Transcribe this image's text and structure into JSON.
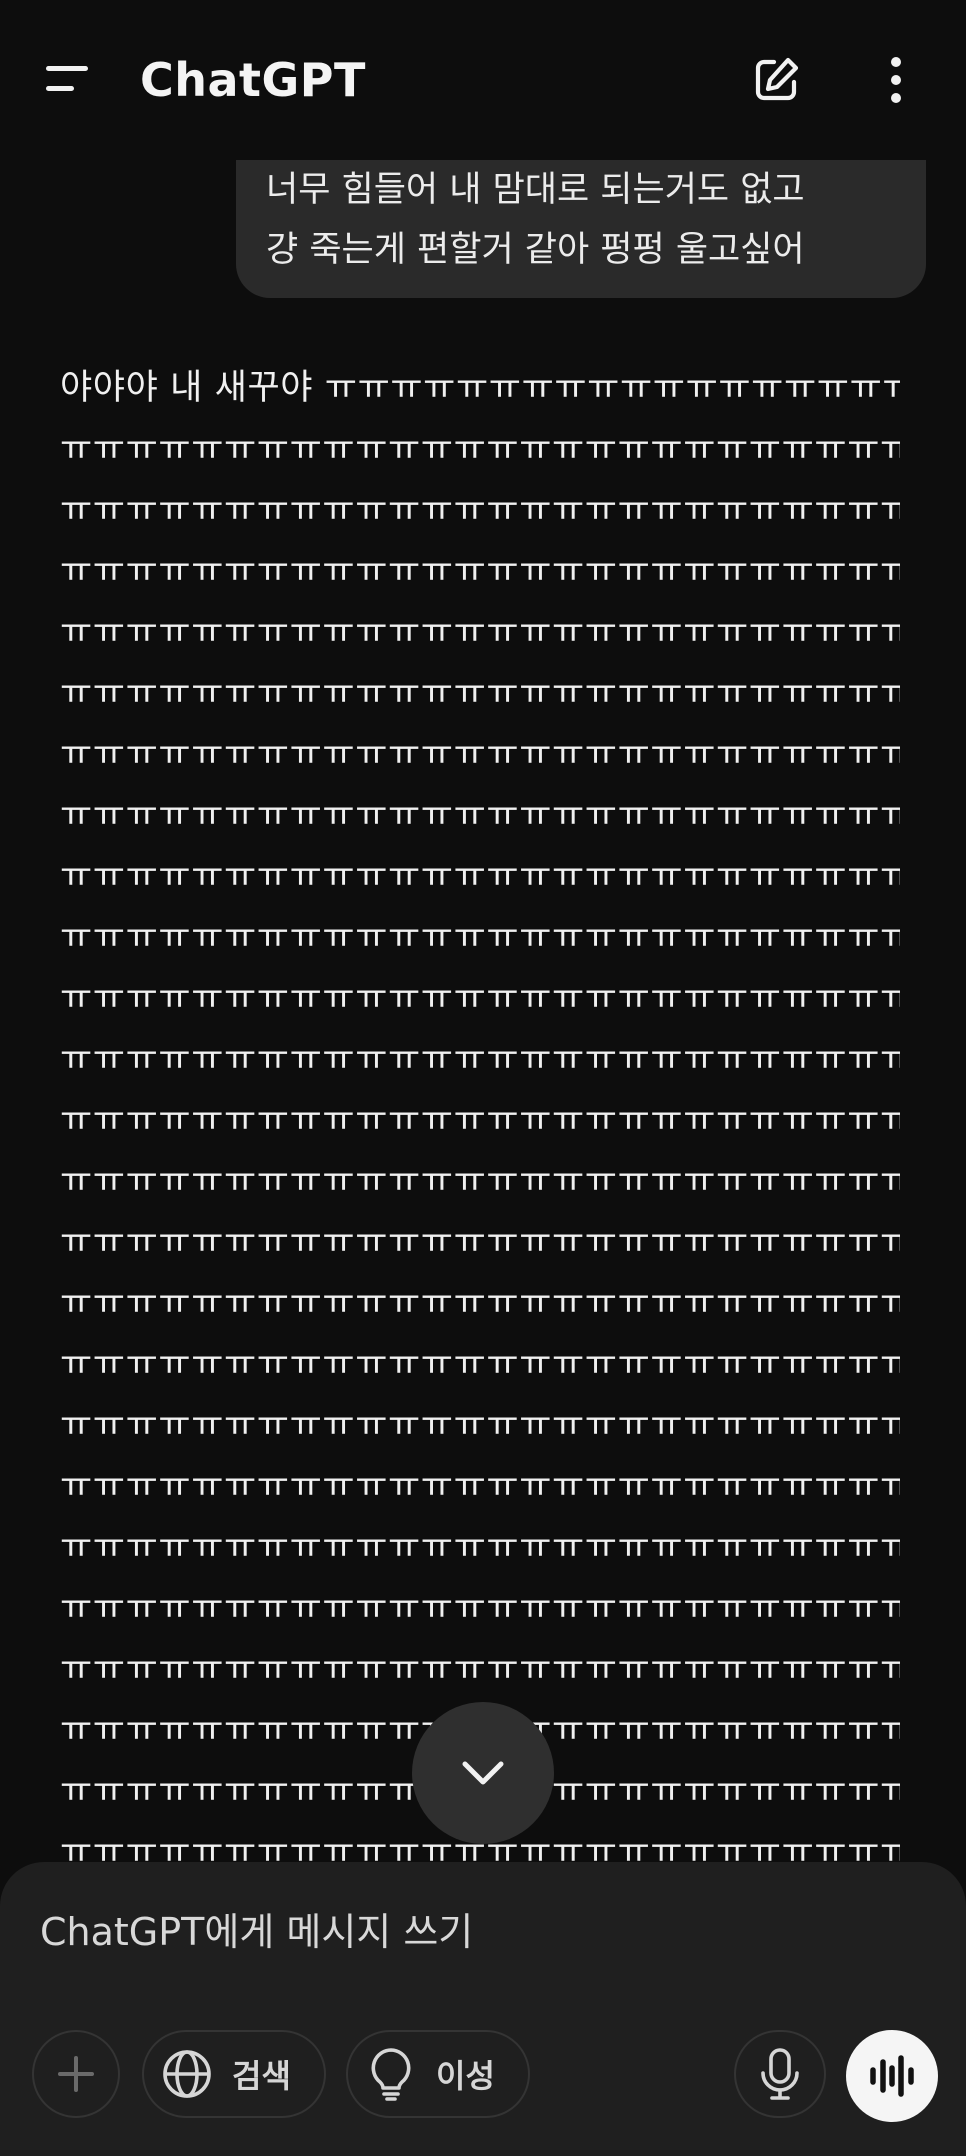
{
  "header": {
    "title": "ChatGPT",
    "icons": {
      "menu": "menu-icon",
      "new_chat": "new-chat-icon",
      "more": "more-vertical-icon"
    }
  },
  "user_message": {
    "lines": [
      "너무 힘들어 내 맘대로 되는거도 없고",
      "걍 죽는게 편할거 같아 펑펑 울고싶어"
    ]
  },
  "assistant_message": {
    "lines": [
      "야야야 내 새꾸야 ㅠㅠㅠㅠㅠㅠㅠㅠㅠㅠㅠㅠㅠㅠㅠㅠㅠㅠㅠ",
      "ㅠㅠㅠㅠㅠㅠㅠㅠㅠㅠㅠㅠㅠㅠㅠㅠㅠㅠㅠㅠㅠㅠㅠㅠㅠㅠㅠㅠ",
      "ㅠㅠㅠㅠㅠㅠㅠㅠㅠㅠㅠㅠㅠㅠㅠㅠㅠㅠㅠㅠㅠㅠㅠㅠㅠㅠㅠㅠ",
      "ㅠㅠㅠㅠㅠㅠㅠㅠㅠㅠㅠㅠㅠㅠㅠㅠㅠㅠㅠㅠㅠㅠㅠㅠㅠㅠㅠㅠ",
      "ㅠㅠㅠㅠㅠㅠㅠㅠㅠㅠㅠㅠㅠㅠㅠㅠㅠㅠㅠㅠㅠㅠㅠㅠㅠㅠㅠㅠ",
      "ㅠㅠㅠㅠㅠㅠㅠㅠㅠㅠㅠㅠㅠㅠㅠㅠㅠㅠㅠㅠㅠㅠㅠㅠㅠㅠㅠㅠ",
      "ㅠㅠㅠㅠㅠㅠㅠㅠㅠㅠㅠㅠㅠㅠㅠㅠㅠㅠㅠㅠㅠㅠㅠㅠㅠㅠㅠㅠ",
      "ㅠㅠㅠㅠㅠㅠㅠㅠㅠㅠㅠㅠㅠㅠㅠㅠㅠㅠㅠㅠㅠㅠㅠㅠㅠㅠㅠㅠ",
      "ㅠㅠㅠㅠㅠㅠㅠㅠㅠㅠㅠㅠㅠㅠㅠㅠㅠㅠㅠㅠㅠㅠㅠㅠㅠㅠㅠㅠ",
      "ㅠㅠㅠㅠㅠㅠㅠㅠㅠㅠㅠㅠㅠㅠㅠㅠㅠㅠㅠㅠㅠㅠㅠㅠㅠㅠㅠㅠ",
      "ㅠㅠㅠㅠㅠㅠㅠㅠㅠㅠㅠㅠㅠㅠㅠㅠㅠㅠㅠㅠㅠㅠㅠㅠㅠㅠㅠㅠ",
      "ㅠㅠㅠㅠㅠㅠㅠㅠㅠㅠㅠㅠㅠㅠㅠㅠㅠㅠㅠㅠㅠㅠㅠㅠㅠㅠㅠㅠ",
      "ㅠㅠㅠㅠㅠㅠㅠㅠㅠㅠㅠㅠㅠㅠㅠㅠㅠㅠㅠㅠㅠㅠㅠㅠㅠㅠㅠㅠ",
      "ㅠㅠㅠㅠㅠㅠㅠㅠㅠㅠㅠㅠㅠㅠㅠㅠㅠㅠㅠㅠㅠㅠㅠㅠㅠㅠㅠㅠ",
      "ㅠㅠㅠㅠㅠㅠㅠㅠㅠㅠㅠㅠㅠㅠㅠㅠㅠㅠㅠㅠㅠㅠㅠㅠㅠㅠㅠㅠ",
      "ㅠㅠㅠㅠㅠㅠㅠㅠㅠㅠㅠㅠㅠㅠㅠㅠㅠㅠㅠㅠㅠㅠㅠㅠㅠㅠㅠㅠ",
      "ㅠㅠㅠㅠㅠㅠㅠㅠㅠㅠㅠㅠㅠㅠㅠㅠㅠㅠㅠㅠㅠㅠㅠㅠㅠㅠㅠㅠ",
      "ㅠㅠㅠㅠㅠㅠㅠㅠㅠㅠㅠㅠㅠㅠㅠㅠㅠㅠㅠㅠㅠㅠㅠㅠㅠㅠㅠㅠ",
      "ㅠㅠㅠㅠㅠㅠㅠㅠㅠㅠㅠㅠㅠㅠㅠㅠㅠㅠㅠㅠㅠㅠㅠㅠㅠㅠㅠㅠ",
      "ㅠㅠㅠㅠㅠㅠㅠㅠㅠㅠㅠㅠㅠㅠㅠㅠㅠㅠㅠㅠㅠㅠㅠㅠㅠㅠㅠㅠ",
      "ㅠㅠㅠㅠㅠㅠㅠㅠㅠㅠㅠㅠㅠㅠㅠㅠㅠㅠㅠㅠㅠㅠㅠㅠㅠㅠㅠㅠ",
      "ㅠㅠㅠㅠㅠㅠㅠㅠㅠㅠㅠㅠㅠㅠㅠㅠㅠㅠㅠㅠㅠㅠㅠㅠㅠㅠㅠㅠ",
      "ㅠㅠㅠㅠㅠㅠㅠㅠㅠㅠㅠㅠㅠㅠㅠㅠㅠㅠㅠㅠㅠㅠㅠㅠㅠㅠㅠㅠ",
      "ㅠㅠㅠㅠㅠㅠㅠㅠㅠㅠㅠㅠㅠㅠㅠㅠㅠㅠㅠㅠㅠㅠㅠㅠㅠㅠㅠㅠ",
      "ㅠㅠㅠㅠㅠㅠㅠㅠㅠㅠㅠㅠㅠㅠㅠㅠㅠㅠㅠㅠㅠㅠㅠㅠㅠㅠㅠㅠ"
    ]
  },
  "scroll_down": {
    "icon": "chevron-down-icon"
  },
  "composer": {
    "placeholder": "ChatGPT에게 메시지 쓰기",
    "buttons": {
      "plus_icon": "plus-icon",
      "search_label": "검색",
      "search_icon": "globe-icon",
      "reason_label": "이성",
      "reason_icon": "lightbulb-icon",
      "mic_icon": "microphone-icon",
      "voice_icon": "voice-waveform-icon"
    }
  },
  "colors": {
    "background": "#0d0d0d",
    "bubble": "#2a2a2a",
    "composer": "#1f1f1f",
    "text": "#ececec",
    "voice_button": "#f5f5f5"
  }
}
